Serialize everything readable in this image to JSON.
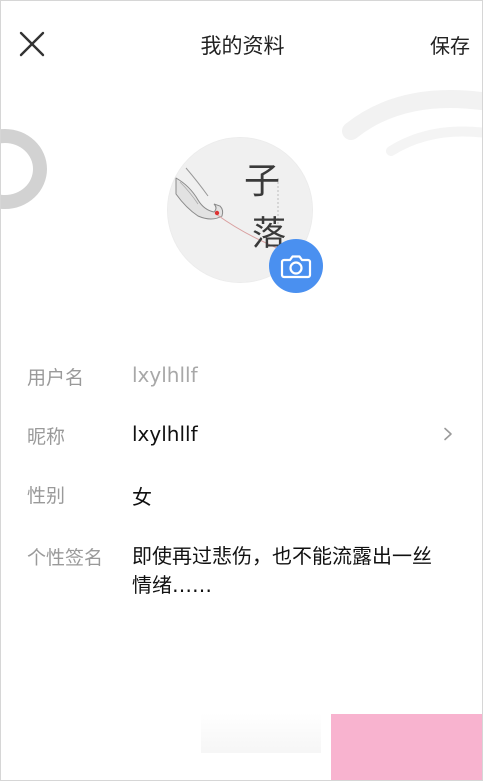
{
  "header": {
    "close_icon": "close-icon",
    "title": "我的资料",
    "save_label": "保存"
  },
  "avatar": {
    "calligraphy_line1": "子",
    "calligraphy_line2": "落",
    "camera_icon": "camera-icon"
  },
  "profile": {
    "username": {
      "label": "用户名",
      "value": "lxylhllf"
    },
    "nickname": {
      "label": "昵称",
      "value": "lxylhllf",
      "chevron_icon": "chevron-right-icon"
    },
    "gender": {
      "label": "性别",
      "value": "女"
    },
    "signature": {
      "label": "个性签名",
      "value": "即使再过悲伤，也不能流露出一丝情绪……"
    }
  },
  "colors": {
    "accent": "#4a90f0",
    "label_grey": "#9a9a9a",
    "muted_value": "#a8a8a8",
    "pink_overlay": "#f8b3cf"
  }
}
